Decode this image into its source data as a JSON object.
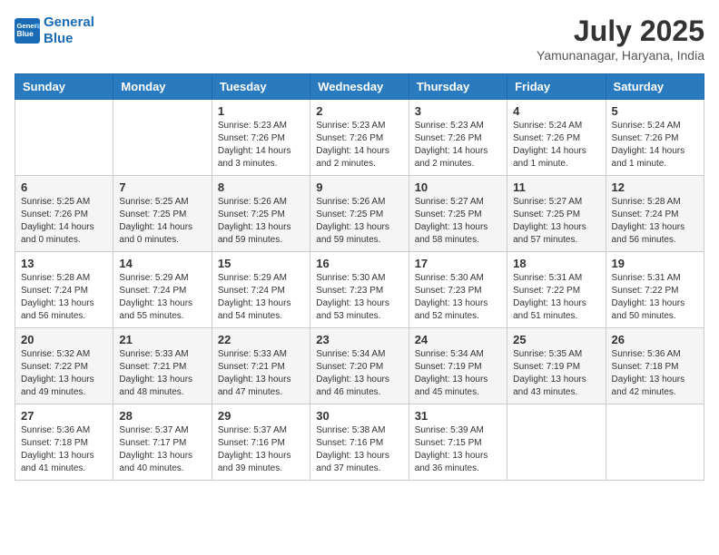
{
  "header": {
    "logo_line1": "General",
    "logo_line2": "Blue",
    "month_year": "July 2025",
    "location": "Yamunanagar, Haryana, India"
  },
  "weekdays": [
    "Sunday",
    "Monday",
    "Tuesday",
    "Wednesday",
    "Thursday",
    "Friday",
    "Saturday"
  ],
  "weeks": [
    [
      {
        "day": "",
        "text": ""
      },
      {
        "day": "",
        "text": ""
      },
      {
        "day": "1",
        "text": "Sunrise: 5:23 AM\nSunset: 7:26 PM\nDaylight: 14 hours\nand 3 minutes."
      },
      {
        "day": "2",
        "text": "Sunrise: 5:23 AM\nSunset: 7:26 PM\nDaylight: 14 hours\nand 2 minutes."
      },
      {
        "day": "3",
        "text": "Sunrise: 5:23 AM\nSunset: 7:26 PM\nDaylight: 14 hours\nand 2 minutes."
      },
      {
        "day": "4",
        "text": "Sunrise: 5:24 AM\nSunset: 7:26 PM\nDaylight: 14 hours\nand 1 minute."
      },
      {
        "day": "5",
        "text": "Sunrise: 5:24 AM\nSunset: 7:26 PM\nDaylight: 14 hours\nand 1 minute."
      }
    ],
    [
      {
        "day": "6",
        "text": "Sunrise: 5:25 AM\nSunset: 7:26 PM\nDaylight: 14 hours\nand 0 minutes."
      },
      {
        "day": "7",
        "text": "Sunrise: 5:25 AM\nSunset: 7:25 PM\nDaylight: 14 hours\nand 0 minutes."
      },
      {
        "day": "8",
        "text": "Sunrise: 5:26 AM\nSunset: 7:25 PM\nDaylight: 13 hours\nand 59 minutes."
      },
      {
        "day": "9",
        "text": "Sunrise: 5:26 AM\nSunset: 7:25 PM\nDaylight: 13 hours\nand 59 minutes."
      },
      {
        "day": "10",
        "text": "Sunrise: 5:27 AM\nSunset: 7:25 PM\nDaylight: 13 hours\nand 58 minutes."
      },
      {
        "day": "11",
        "text": "Sunrise: 5:27 AM\nSunset: 7:25 PM\nDaylight: 13 hours\nand 57 minutes."
      },
      {
        "day": "12",
        "text": "Sunrise: 5:28 AM\nSunset: 7:24 PM\nDaylight: 13 hours\nand 56 minutes."
      }
    ],
    [
      {
        "day": "13",
        "text": "Sunrise: 5:28 AM\nSunset: 7:24 PM\nDaylight: 13 hours\nand 56 minutes."
      },
      {
        "day": "14",
        "text": "Sunrise: 5:29 AM\nSunset: 7:24 PM\nDaylight: 13 hours\nand 55 minutes."
      },
      {
        "day": "15",
        "text": "Sunrise: 5:29 AM\nSunset: 7:24 PM\nDaylight: 13 hours\nand 54 minutes."
      },
      {
        "day": "16",
        "text": "Sunrise: 5:30 AM\nSunset: 7:23 PM\nDaylight: 13 hours\nand 53 minutes."
      },
      {
        "day": "17",
        "text": "Sunrise: 5:30 AM\nSunset: 7:23 PM\nDaylight: 13 hours\nand 52 minutes."
      },
      {
        "day": "18",
        "text": "Sunrise: 5:31 AM\nSunset: 7:22 PM\nDaylight: 13 hours\nand 51 minutes."
      },
      {
        "day": "19",
        "text": "Sunrise: 5:31 AM\nSunset: 7:22 PM\nDaylight: 13 hours\nand 50 minutes."
      }
    ],
    [
      {
        "day": "20",
        "text": "Sunrise: 5:32 AM\nSunset: 7:22 PM\nDaylight: 13 hours\nand 49 minutes."
      },
      {
        "day": "21",
        "text": "Sunrise: 5:33 AM\nSunset: 7:21 PM\nDaylight: 13 hours\nand 48 minutes."
      },
      {
        "day": "22",
        "text": "Sunrise: 5:33 AM\nSunset: 7:21 PM\nDaylight: 13 hours\nand 47 minutes."
      },
      {
        "day": "23",
        "text": "Sunrise: 5:34 AM\nSunset: 7:20 PM\nDaylight: 13 hours\nand 46 minutes."
      },
      {
        "day": "24",
        "text": "Sunrise: 5:34 AM\nSunset: 7:19 PM\nDaylight: 13 hours\nand 45 minutes."
      },
      {
        "day": "25",
        "text": "Sunrise: 5:35 AM\nSunset: 7:19 PM\nDaylight: 13 hours\nand 43 minutes."
      },
      {
        "day": "26",
        "text": "Sunrise: 5:36 AM\nSunset: 7:18 PM\nDaylight: 13 hours\nand 42 minutes."
      }
    ],
    [
      {
        "day": "27",
        "text": "Sunrise: 5:36 AM\nSunset: 7:18 PM\nDaylight: 13 hours\nand 41 minutes."
      },
      {
        "day": "28",
        "text": "Sunrise: 5:37 AM\nSunset: 7:17 PM\nDaylight: 13 hours\nand 40 minutes."
      },
      {
        "day": "29",
        "text": "Sunrise: 5:37 AM\nSunset: 7:16 PM\nDaylight: 13 hours\nand 39 minutes."
      },
      {
        "day": "30",
        "text": "Sunrise: 5:38 AM\nSunset: 7:16 PM\nDaylight: 13 hours\nand 37 minutes."
      },
      {
        "day": "31",
        "text": "Sunrise: 5:39 AM\nSunset: 7:15 PM\nDaylight: 13 hours\nand 36 minutes."
      },
      {
        "day": "",
        "text": ""
      },
      {
        "day": "",
        "text": ""
      }
    ]
  ]
}
